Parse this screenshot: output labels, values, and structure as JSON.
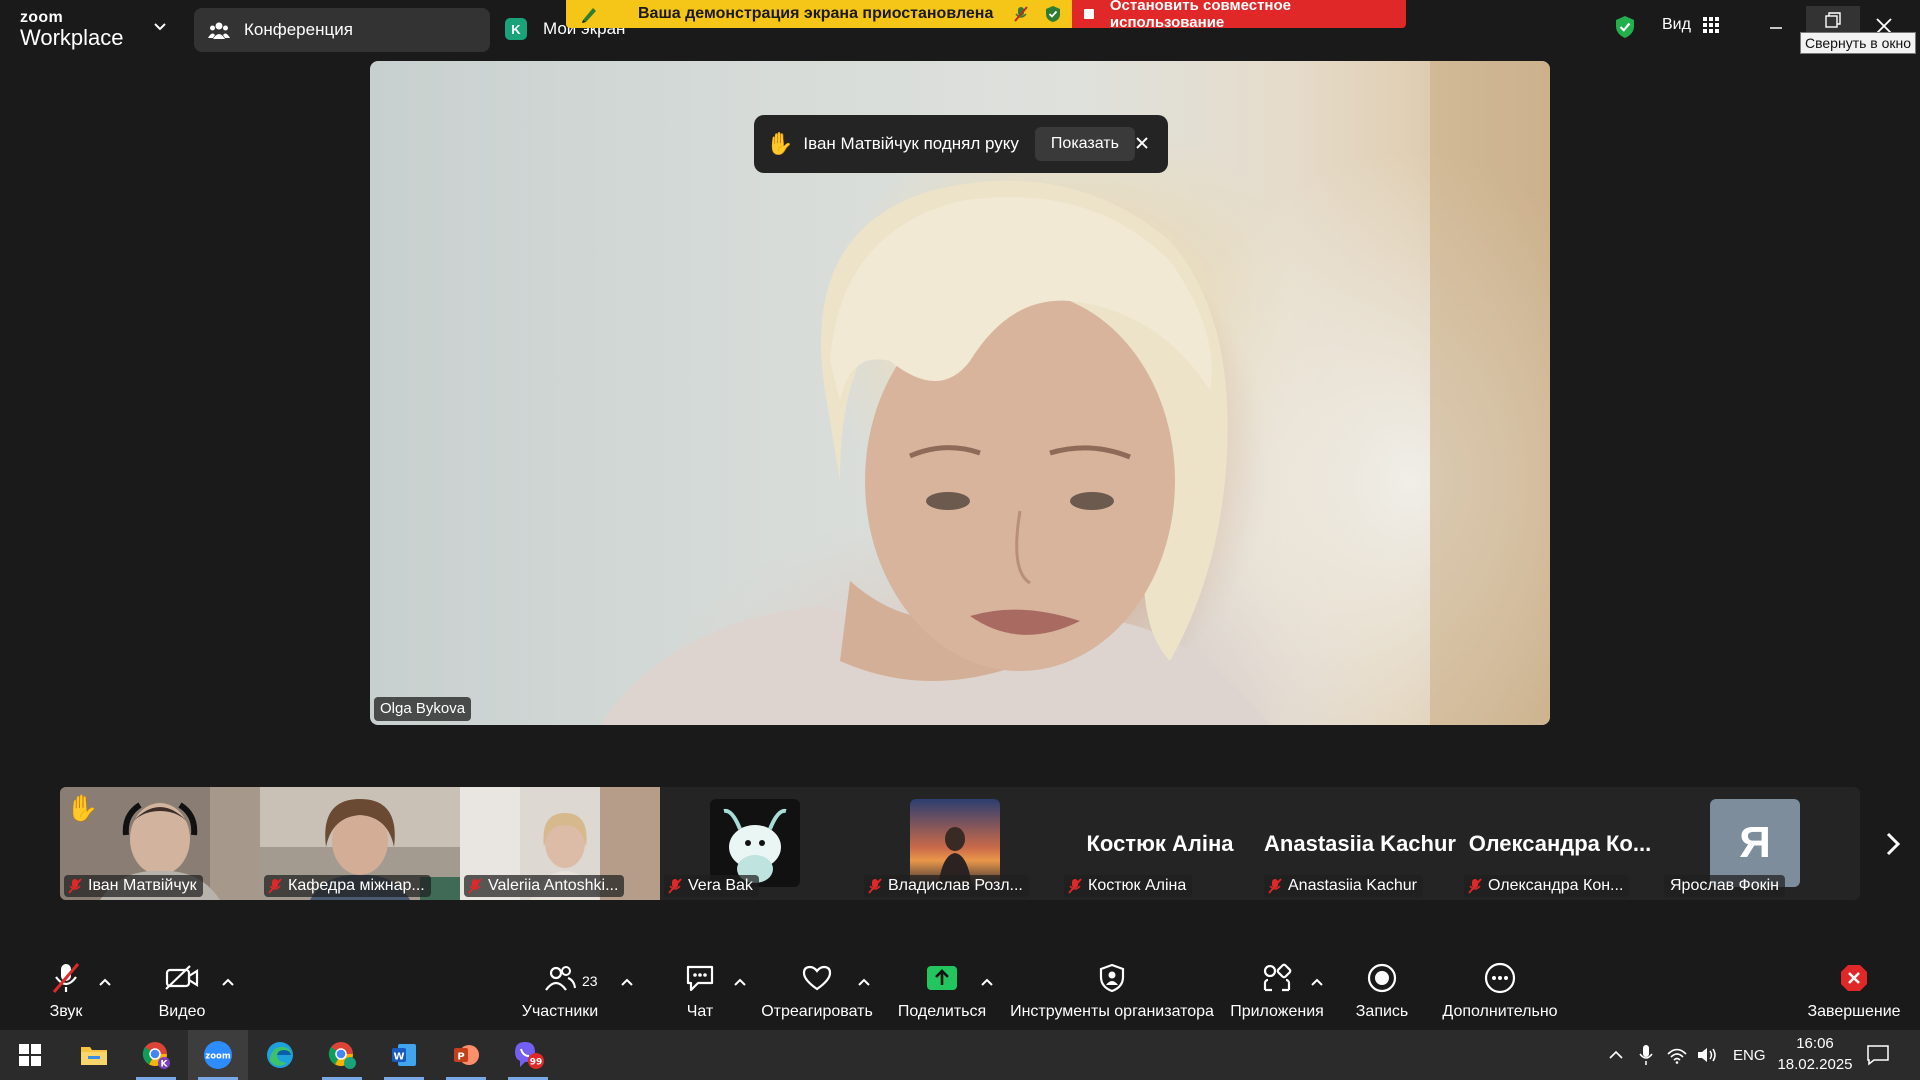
{
  "app": {
    "logo_line1": "zoom",
    "logo_line2": "Workplace"
  },
  "tabs": {
    "conference": "Конференция",
    "my_screen_badge": "K",
    "my_screen": "Мой экран"
  },
  "banner": {
    "paused": "Ваша демонстрация экрана приостановлена",
    "stop": "Остановить совместное использование",
    "paused_color": "#f5c518",
    "stop_color": "#e02828"
  },
  "window": {
    "view_label": "Вид",
    "restore_tooltip": "Свернуть в окно"
  },
  "main_video": {
    "speaker": "Olga Bykova"
  },
  "toast": {
    "hand_emoji": "✋",
    "message": "Іван Матвійчук поднял руку",
    "show_button": "Показать"
  },
  "gallery": [
    {
      "name": "Іван Матвійчук",
      "muted": true,
      "hand_raised": true,
      "hand": "✋"
    },
    {
      "name": "Кафедра міжнар...",
      "muted": true
    },
    {
      "name": "Valeriia Antoshki...",
      "muted": true
    },
    {
      "name": "Vera Bak",
      "muted": true
    },
    {
      "name": "Владислав Розл...",
      "muted": true
    },
    {
      "name": "Костюк Аліна",
      "big_name": "Костюк Аліна",
      "muted": true
    },
    {
      "name": "Anastasiia Kachur",
      "big_name": "Anastasiia Kachur",
      "muted": true
    },
    {
      "name": "Олександра Кон...",
      "big_name": "Олександра  Ко...",
      "muted": true
    },
    {
      "name": "Ярослав Фокін",
      "avatar_letter": "Я",
      "muted": false
    }
  ],
  "toolbar": {
    "audio": "Звук",
    "video": "Видео",
    "participants": "Участники",
    "participants_count": "23",
    "chat": "Чат",
    "react": "Отреагировать",
    "share": "Поделиться",
    "host_tools": "Инструменты организатора",
    "apps": "Приложения",
    "record": "Запись",
    "more": "Дополнительно",
    "end": "Завершение",
    "share_color": "#22c55e",
    "end_color": "#e02828"
  },
  "taskbar": {
    "icons": [
      "windows-start-icon",
      "file-explorer-icon",
      "chrome-profile-icon",
      "zoom-app-icon",
      "edge-icon",
      "chrome-icon",
      "word-icon",
      "powerpoint-icon",
      "viber-icon"
    ],
    "zoom_label": "zoom",
    "viber_badge": "99",
    "chrome_badge": "K",
    "lang": "ENG",
    "time": "16:06",
    "date": "18.02.2025"
  }
}
